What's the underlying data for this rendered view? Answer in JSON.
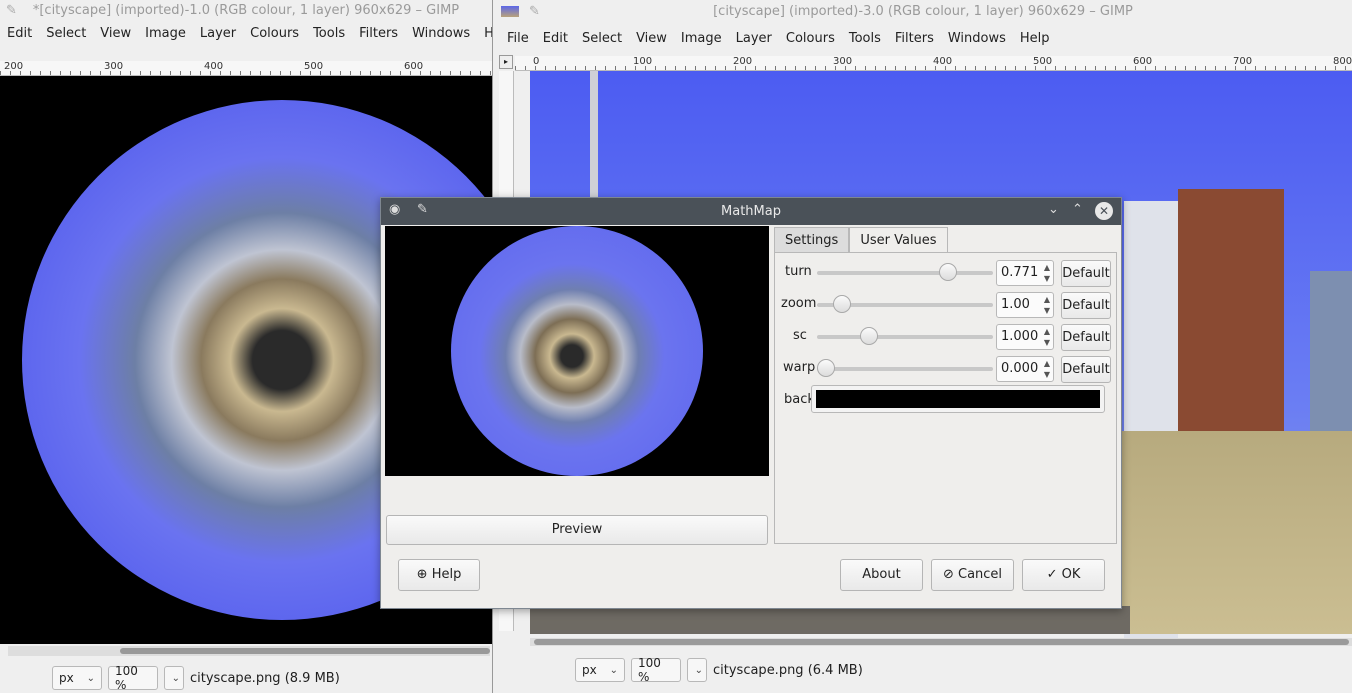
{
  "left_window": {
    "title": "*[cityscape] (imported)-1.0 (RGB colour, 1 layer) 960x629 – GIMP",
    "menu": [
      "Edit",
      "Select",
      "View",
      "Image",
      "Layer",
      "Colours",
      "Tools",
      "Filters",
      "Windows",
      "Help"
    ],
    "ruler_ticks": [
      "200",
      "300",
      "400",
      "500",
      "600"
    ],
    "unit": "px",
    "zoom": "100 %",
    "status": "cityscape.png (8.9 MB)"
  },
  "right_window": {
    "title": "[cityscape] (imported)-3.0 (RGB colour, 1 layer) 960x629 – GIMP",
    "menu": [
      "File",
      "Edit",
      "Select",
      "View",
      "Image",
      "Layer",
      "Colours",
      "Tools",
      "Filters",
      "Windows",
      "Help"
    ],
    "ruler_ticks": [
      "0",
      "100",
      "200",
      "300",
      "400",
      "500",
      "600",
      "700",
      "800"
    ],
    "unit": "px",
    "zoom": "100 %",
    "status": "cityscape.png (6.4 MB)"
  },
  "dialog": {
    "title": "MathMap",
    "tabs": [
      "Settings",
      "User Values"
    ],
    "active_tab": "User Values",
    "preview_button": "Preview",
    "help_button": "Help",
    "about_button": "About",
    "cancel_button": "Cancel",
    "ok_button": "OK",
    "default_label": "Default",
    "params": [
      {
        "name": "turn",
        "value": "0.771",
        "level": 0.77
      },
      {
        "name": "zoom",
        "value": "1.00",
        "level": 0.1
      },
      {
        "name": "sc",
        "value": "1.000",
        "level": 0.27
      },
      {
        "name": "warp",
        "value": "0.000",
        "level": 0.0
      }
    ],
    "back_label": "back",
    "back_color": "#000000"
  }
}
